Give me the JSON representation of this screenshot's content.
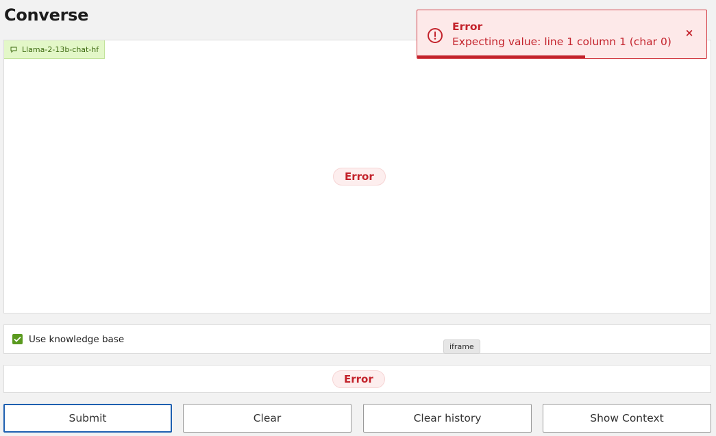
{
  "page": {
    "title": "Converse"
  },
  "chat": {
    "model_label": "Llama-2-13b-chat-hf",
    "error_label": "Error"
  },
  "knowledge_base": {
    "label": "Use knowledge base",
    "checked": true
  },
  "tooltip": {
    "text": "iframe"
  },
  "input": {
    "error_label": "Error"
  },
  "buttons": {
    "submit": "Submit",
    "clear": "Clear",
    "clear_history": "Clear history",
    "show_context": "Show Context"
  },
  "toast": {
    "title": "Error",
    "message": "Expecting value: line 1 column 1 (char 0)",
    "close_symbol": "×",
    "progress_fraction": 0.58
  },
  "colors": {
    "error_red": "#c3222b",
    "primary_blue": "#1d5fb0",
    "check_green": "#5a9a1f"
  }
}
